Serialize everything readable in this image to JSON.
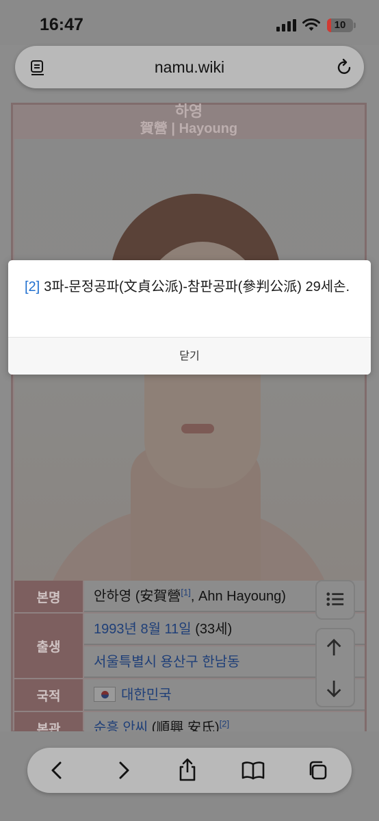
{
  "status_bar": {
    "time": "16:47",
    "battery": "10"
  },
  "browser": {
    "url": "namu.wiki"
  },
  "profile": {
    "name_stub": "하영",
    "caption": "賀營 | Hayoung"
  },
  "info_rows": [
    {
      "label": "본명",
      "value_text": "안하영 (安賀營",
      "value_ref": "[1]",
      "value_suffix": ", Ahn Hayoung)"
    },
    {
      "label": "출생",
      "birth_date": "1993년 8월 11일",
      "age": " (33세)",
      "birth_place": "서울특별시 용산구 한남동"
    },
    {
      "label": "국적",
      "value_link": "대한민국"
    },
    {
      "label": "본관",
      "value_link": "순흥 안씨",
      "value_text": " (順興 安氏)",
      "value_ref": "[2]"
    }
  ],
  "popup": {
    "ref": "[2]",
    "text": "3파-문정공파(文貞公派)-참판공파(參判公派) 29세손.",
    "close_label": "닫기"
  },
  "colors": {
    "link": "#1f6fcf",
    "battery_low": "#d13a33"
  },
  "icons": [
    "reader-icon",
    "reload-icon",
    "back-icon",
    "forward-icon",
    "share-icon",
    "bookmarks-icon",
    "tabs-icon",
    "toc-icon",
    "scroll-up-icon",
    "scroll-down-icon"
  ]
}
